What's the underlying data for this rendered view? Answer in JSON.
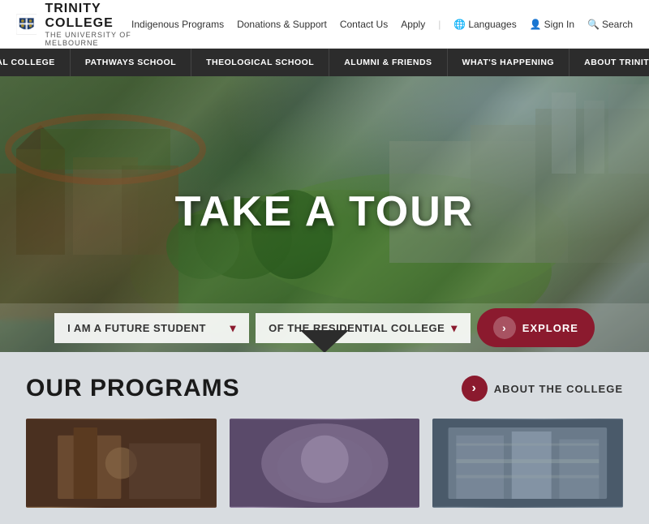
{
  "logo": {
    "title": "TRINITY COLLEGE",
    "subtitle": "THE UNIVERSITY OF MELBOURNE"
  },
  "top_nav": {
    "items": [
      {
        "label": "Indigenous Programs"
      },
      {
        "label": "Donations & Support"
      },
      {
        "label": "Contact Us"
      },
      {
        "label": "Apply"
      },
      {
        "label": "Languages"
      },
      {
        "label": "Sign In"
      },
      {
        "label": "Search"
      }
    ]
  },
  "main_nav": {
    "items": [
      {
        "label": "RESIDENTIAL COLLEGE"
      },
      {
        "label": "PATHWAYS SCHOOL"
      },
      {
        "label": "THEOLOGICAL SCHOOL"
      },
      {
        "label": "ALUMNI & FRIENDS"
      },
      {
        "label": "WHAT'S HAPPENING"
      },
      {
        "label": "ABOUT TRINITY COLLEGE"
      }
    ]
  },
  "hero": {
    "title": "TAKE A TOUR",
    "selector_1": "I AM A FUTURE STUDENT",
    "selector_2": "OF THE RESIDENTIAL COLLEGE",
    "explore_label": "EXPLORE"
  },
  "programs": {
    "title": "OUR PROGRAMS",
    "about_label": "ABOUT THE COLLEGE",
    "cards": [
      {
        "alt": "Program card 1"
      },
      {
        "alt": "Program card 2"
      },
      {
        "alt": "Program card 3"
      }
    ]
  }
}
